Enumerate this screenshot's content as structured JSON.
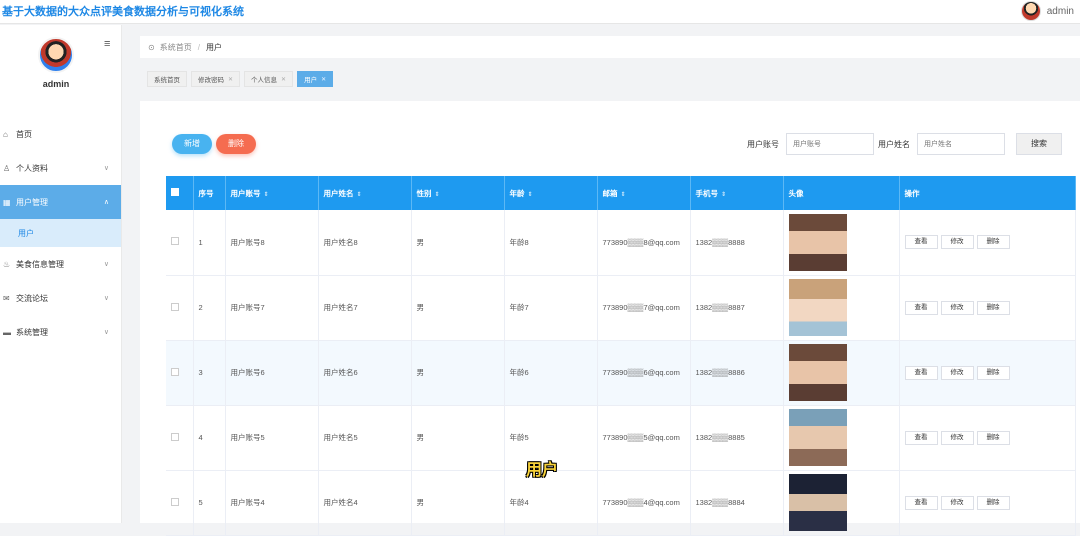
{
  "app": {
    "title": "基于大数据的大众点评美食数据分析与可视化系统",
    "user": "admin"
  },
  "sidebar": {
    "username": "admin",
    "menu_icon": "menu-icon",
    "items": [
      {
        "label": "首页",
        "icon": "home-icon"
      },
      {
        "label": "个人资料",
        "icon": "user-icon"
      },
      {
        "label": "用户管理",
        "icon": "grid-icon",
        "active": true
      },
      {
        "label": "美食信息管理",
        "icon": "food-icon"
      },
      {
        "label": "交流论坛",
        "icon": "mail-icon"
      },
      {
        "label": "系统管理",
        "icon": "monitor-icon"
      }
    ],
    "sub_item": "用户"
  },
  "breadcrumb": {
    "home": "系统首页",
    "current": "用户"
  },
  "tags": [
    "系统首页",
    "修改密码",
    "个人信息",
    "用户"
  ],
  "toolbar": {
    "add_label": "新增",
    "delete_label": "删除",
    "account_label": "用户账号",
    "account_placeholder": "用户账号",
    "name_label": "用户姓名",
    "name_placeholder": "用户姓名",
    "search_label": "搜索"
  },
  "table": {
    "headers": [
      "序号",
      "用户账号",
      "用户姓名",
      "性别",
      "年龄",
      "邮箱",
      "手机号",
      "头像",
      "操作"
    ],
    "actions": [
      "查看",
      "修改",
      "删除"
    ],
    "rows": [
      {
        "no": "1",
        "account": "用户账号8",
        "name": "用户姓名8",
        "gender": "男",
        "age": "年龄8",
        "email": "773890▒▒▒8@qq.com",
        "phone": "1382▒▒▒8888"
      },
      {
        "no": "2",
        "account": "用户账号7",
        "name": "用户姓名7",
        "gender": "男",
        "age": "年龄7",
        "email": "773890▒▒▒7@qq.com",
        "phone": "1382▒▒▒8887"
      },
      {
        "no": "3",
        "account": "用户账号6",
        "name": "用户姓名6",
        "gender": "男",
        "age": "年龄6",
        "email": "773890▒▒▒6@qq.com",
        "phone": "1382▒▒▒8886"
      },
      {
        "no": "4",
        "account": "用户账号5",
        "name": "用户姓名5",
        "gender": "男",
        "age": "年龄5",
        "email": "773890▒▒▒5@qq.com",
        "phone": "1382▒▒▒8885"
      },
      {
        "no": "5",
        "account": "用户账号4",
        "name": "用户姓名4",
        "gender": "男",
        "age": "年龄4",
        "email": "773890▒▒▒4@qq.com",
        "phone": "1382▒▒▒8884"
      }
    ]
  },
  "overlay_caption": "用户",
  "colors": {
    "primary": "#1e9af0",
    "danger": "#f56c50",
    "sidebar_active": "#5cace8"
  }
}
